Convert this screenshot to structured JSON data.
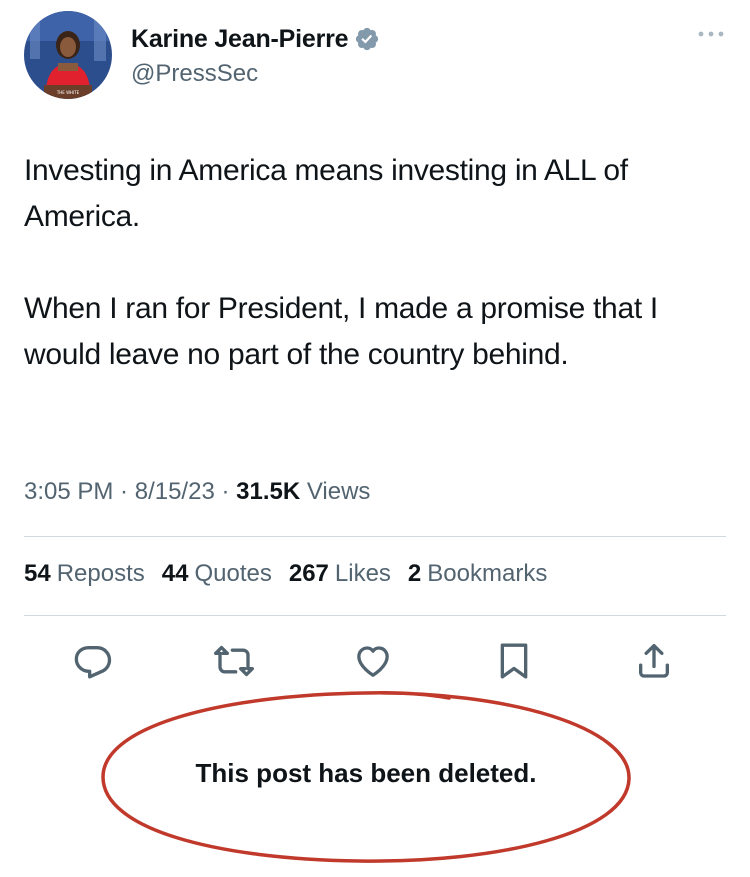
{
  "author": {
    "display_name": "Karine Jean-Pierre",
    "handle": "@PressSec",
    "avatar_icon": "profile-photo-icon",
    "verified_icon": "verified-badge-icon",
    "verified_color": "#829aab",
    "avatar_podium_text": "THE WHITE"
  },
  "tweet": {
    "paragraphs": [
      "Investing in America means investing in ALL of America.",
      "When I ran for President, I made a promise that I would leave no part of the country behind."
    ]
  },
  "meta": {
    "time": "3:05 PM",
    "separator": " · ",
    "date": "8/15/23",
    "views_count": "31.5K",
    "views_label": "Views"
  },
  "stats": [
    {
      "count": "54",
      "label": "Reposts"
    },
    {
      "count": "44",
      "label": "Quotes"
    },
    {
      "count": "267",
      "label": "Likes"
    },
    {
      "count": "2",
      "label": "Bookmarks"
    }
  ],
  "actions": [
    {
      "name": "reply-icon"
    },
    {
      "name": "repost-icon"
    },
    {
      "name": "like-icon"
    },
    {
      "name": "bookmark-icon"
    },
    {
      "name": "share-icon"
    }
  ],
  "annotation": {
    "text": "This post has been deleted.",
    "oval_color": "#c0392b"
  },
  "colors": {
    "primary_text": "#0f1419",
    "secondary_text": "#536471",
    "divider": "#cfd9de",
    "icon": "#536471"
  }
}
